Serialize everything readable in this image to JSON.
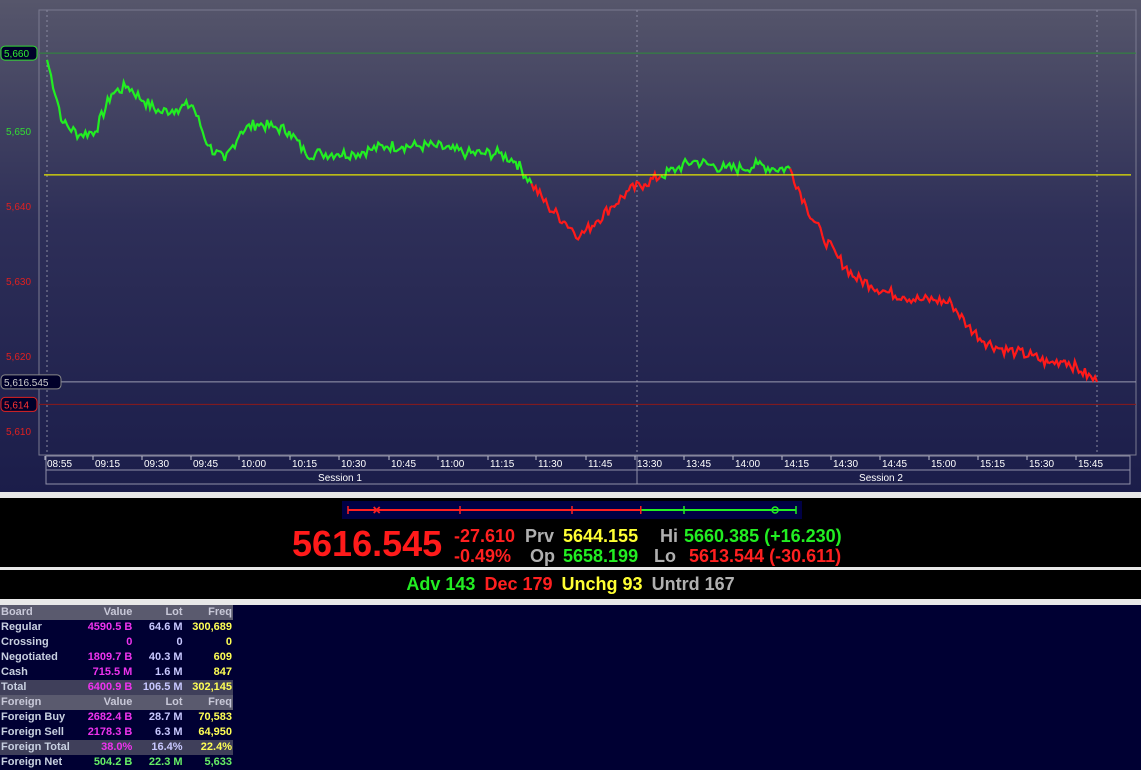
{
  "chart": {
    "y_labels": [
      {
        "value": 5650,
        "label": "5,650"
      },
      {
        "value": 5640,
        "label": "5,640"
      },
      {
        "value": 5630,
        "label": "5,630"
      },
      {
        "value": 5620,
        "label": "5,620"
      },
      {
        "value": 5610,
        "label": "5,610"
      }
    ],
    "high_label": {
      "value": 5660.385,
      "label": "5,660"
    },
    "last_label": {
      "value": 5616.545,
      "label": "5,616.545"
    },
    "low_label": {
      "value": 5613.544,
      "label": "5,614"
    },
    "previous_close": 5644.155,
    "x_labels": [
      "08:55",
      "09:15",
      "09:30",
      "09:45",
      "10:00",
      "10:15",
      "10:30",
      "10:45",
      "11:00",
      "11:15",
      "11:30",
      "11:45",
      "13:30",
      "13:45",
      "14:00",
      "14:15",
      "14:30",
      "14:45",
      "15:00",
      "15:15",
      "15:30",
      "15:45"
    ],
    "sessions": [
      "Session 1",
      "Session 2"
    ],
    "colors": {
      "up": "#22ee22",
      "down": "#ff1a1a",
      "prev_line": "#e6e600",
      "high_line": "#2e8b3a",
      "low_line": "#8b1a1a"
    }
  },
  "chart_data": {
    "type": "line",
    "title": "",
    "xlabel": "",
    "ylabel": "",
    "ylim": [
      5606,
      5666
    ],
    "x": [
      "08:55",
      "09:00",
      "09:05",
      "09:10",
      "09:15",
      "09:20",
      "09:25",
      "09:30",
      "09:35",
      "09:40",
      "09:45",
      "09:50",
      "09:55",
      "10:00",
      "10:05",
      "10:10",
      "10:15",
      "10:20",
      "10:25",
      "10:30",
      "10:35",
      "10:40",
      "10:45",
      "10:50",
      "10:55",
      "11:00",
      "11:05",
      "11:10",
      "11:15",
      "11:20",
      "11:25",
      "11:30",
      "11:35",
      "11:40",
      "11:45",
      "11:50",
      "11:55",
      "13:30",
      "13:35",
      "13:40",
      "13:45",
      "13:50",
      "13:55",
      "14:00",
      "14:05",
      "14:10",
      "14:15",
      "14:20",
      "14:25",
      "14:30",
      "14:35",
      "14:40",
      "14:45",
      "14:50",
      "14:55",
      "15:00",
      "15:05",
      "15:10",
      "15:15",
      "15:20",
      "15:25",
      "15:30",
      "15:35",
      "15:40",
      "15:45",
      "15:48"
    ],
    "series": [
      {
        "values": [
          5659.5,
          5651,
          5649.5,
          5650,
          5655,
          5656,
          5654,
          5652.5,
          5653,
          5653.5,
          5648,
          5646,
          5650,
          5651,
          5650.5,
          5650,
          5647,
          5647,
          5647,
          5647,
          5647.5,
          5648,
          5648,
          5648,
          5648,
          5647.5,
          5647,
          5647,
          5647,
          5646,
          5643,
          5640,
          5638,
          5636,
          5638,
          5640,
          5642,
          5643,
          5644,
          5645,
          5646,
          5645.5,
          5645,
          5645,
          5645.5,
          5645,
          5645,
          5640,
          5636,
          5633,
          5630.5,
          5629.5,
          5628.5,
          5628,
          5627.5,
          5627.5,
          5627,
          5624,
          5622,
          5621,
          5620.5,
          5620,
          5619,
          5619.5,
          5618,
          5616.545
        ]
      }
    ],
    "previous_close": 5644.155,
    "high": 5660.385,
    "low": 5613.544,
    "last": 5616.545
  },
  "quote": {
    "last": "5616.545",
    "change": "-27.610",
    "change_pct": "-0.49%",
    "prv_label": "Prv",
    "prv_value": "5644.155",
    "op_label": "Op",
    "op_value": "5658.199",
    "hi_label": "Hi",
    "hi_value": "5660.385 (+16.230)",
    "lo_label": "Lo",
    "lo_value": "5613.544 (-30.611)"
  },
  "range_bar": {
    "low": 5613.544,
    "high": 5660.385,
    "prev": 5644.155,
    "open": 5658.199,
    "last": 5616.545
  },
  "stats": {
    "adv": "Adv 143",
    "dec": "Dec 179",
    "unchg": "Unchg 93",
    "untrd": "Untrd 167"
  },
  "board_table": {
    "header": {
      "name": "Board",
      "value": "Value",
      "lot": "Lot",
      "freq": "Freq"
    },
    "rows": [
      {
        "name": "Regular",
        "value": "4590.5 B",
        "lot": "64.6 M",
        "freq": "300,689"
      },
      {
        "name": "Crossing",
        "value": "0",
        "lot": "0",
        "freq": "0"
      },
      {
        "name": "Negotiated",
        "value": "1809.7 B",
        "lot": "40.3 M",
        "freq": "609"
      },
      {
        "name": "Cash",
        "value": "715.5 M",
        "lot": "1.6 M",
        "freq": "847"
      },
      {
        "name": "Total",
        "value": "6400.9 B",
        "lot": "106.5 M",
        "freq": "302,145"
      }
    ]
  },
  "foreign_table": {
    "header": {
      "name": "Foreign",
      "value": "Value",
      "lot": "Lot",
      "freq": "Freq"
    },
    "rows": [
      {
        "name": "Foreign Buy",
        "value": "2682.4 B",
        "lot": "28.7 M",
        "freq": "70,583"
      },
      {
        "name": "Foreign Sell",
        "value": "2178.3 B",
        "lot": "6.3 M",
        "freq": "64,950"
      },
      {
        "name": "Foreign Total",
        "value": "38.0%",
        "lot": "16.4%",
        "freq": "22.4%"
      },
      {
        "name": "Foreign Net",
        "value": "504.2 B",
        "lot": "22.3 M",
        "freq": "5,633"
      }
    ]
  }
}
